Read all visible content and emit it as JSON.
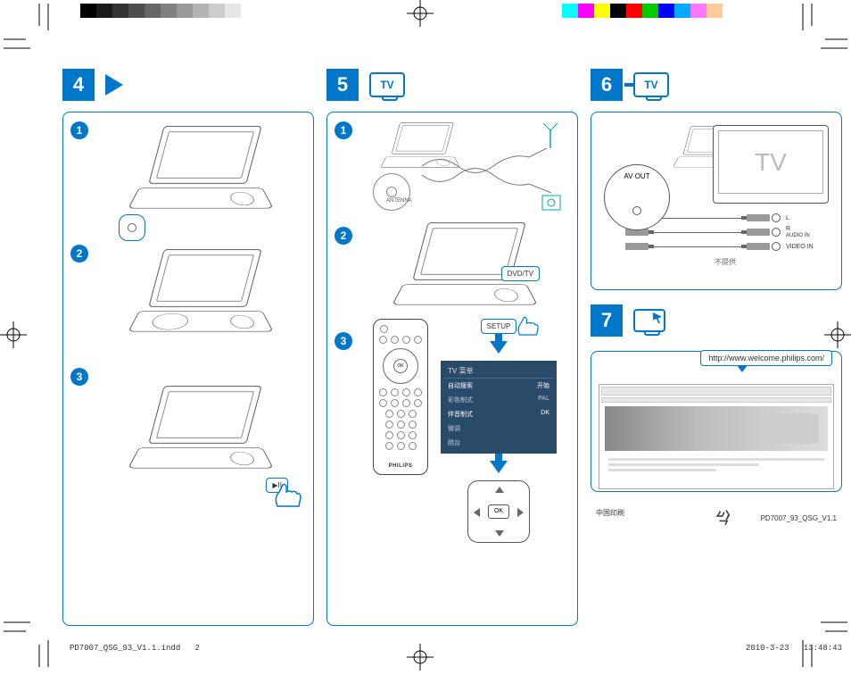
{
  "steps": {
    "s4": {
      "num": "4"
    },
    "s5": {
      "num": "5",
      "icon_label": "TV"
    },
    "s6": {
      "num": "6",
      "icon_label": "TV"
    },
    "s7": {
      "num": "7"
    }
  },
  "sub_numbers": [
    "1",
    "2",
    "3"
  ],
  "callouts": {
    "play_pause": "▶II",
    "dvd_tv": "DVD/TV",
    "setup": "SETUP",
    "antenna": "ANTENNA"
  },
  "remote": {
    "ok": "OK",
    "brand": "PHILIPS"
  },
  "tv_menu": {
    "title": "TV 菜单",
    "rows": [
      {
        "label": "自动搜索",
        "value": "开始"
      },
      {
        "label": "彩色制式",
        "value": "PAL"
      },
      {
        "label": "伴音制式",
        "value": "DK"
      },
      {
        "label": "微调",
        "value": ""
      },
      {
        "label": "跳台",
        "value": ""
      }
    ]
  },
  "dpad_ok": "OK",
  "connections": {
    "av_out": "AV OUT",
    "tv_text": "TV",
    "audio_l": "L",
    "audio_r": "R",
    "audio_in": "AUDIO IN",
    "video_in": "VIDEO IN",
    "not_supplied": "不提供"
  },
  "website": {
    "url": "http://www.welcome.philips.com/"
  },
  "footer": {
    "print_location": "中国印刷",
    "doc_id": "PD7007_93_QSG_V1.1",
    "indd_file": "PD7007_QSG_93_V1.1.indd",
    "indd_page": "2",
    "timestamp_date": "2010-3-23",
    "timestamp_time": "13:48:43"
  }
}
